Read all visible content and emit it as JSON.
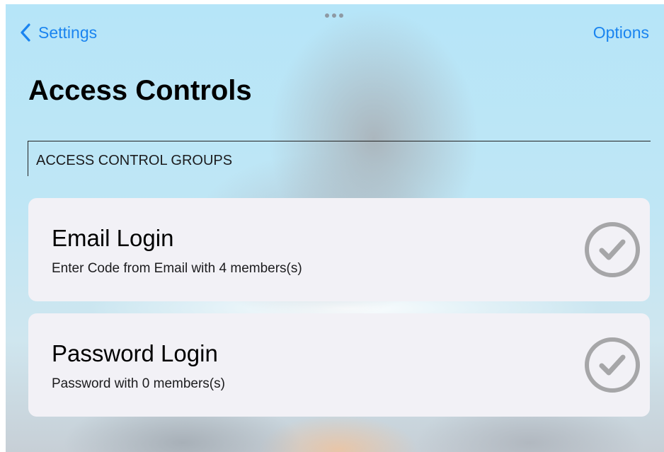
{
  "nav": {
    "back_label": "Settings",
    "options_label": "Options"
  },
  "page": {
    "title": "Access Controls"
  },
  "section": {
    "header": "ACCESS CONTROL GROUPS"
  },
  "groups": [
    {
      "title": "Email Login",
      "subtitle": "Enter Code from Email with 4 members(s)",
      "icon": "checkmark-circle-icon"
    },
    {
      "title": "Password Login",
      "subtitle": "Password with 0 members(s)",
      "icon": "checkmark-circle-icon"
    }
  ],
  "colors": {
    "accent": "#1a84f0",
    "card_background": "#f2f1f6",
    "check_icon": "#a6a6a8"
  }
}
